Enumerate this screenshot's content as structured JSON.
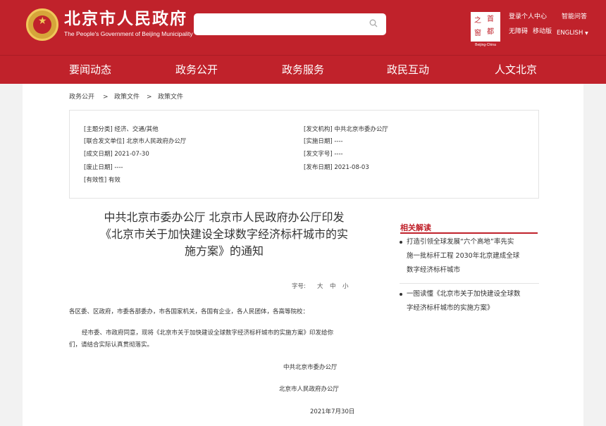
{
  "header": {
    "site_title": "北京市人民政府",
    "site_subtitle": "The People's Government of Beijing Municipality",
    "search": {
      "placeholder": ""
    },
    "logo_chars": [
      "之",
      "首",
      "窗",
      "都"
    ],
    "logo_caption": "Beijing-China",
    "links": {
      "personal_center": "登录个人中心",
      "smart_qa": "智能问答",
      "accessibility": "无障碍",
      "mobile": "移动版",
      "language": "ENGLISH"
    }
  },
  "nav": [
    "要闻动态",
    "政务公开",
    "政务服务",
    "政民互动",
    "人文北京"
  ],
  "breadcrumb": [
    "政务公开",
    "政策文件",
    "政策文件"
  ],
  "meta_left": [
    "[主题分类] 经济、交通/其他",
    "[联合发文单位] 北京市人民政府办公厅",
    "[成文日期] 2021-07-30",
    "[废止日期] ----",
    "[有效性] 有效"
  ],
  "meta_right": [
    "[发文机构] 中共北京市委办公厅",
    "[实施日期] ----",
    "[发文字号] ----",
    "[发布日期] 2021-08-03"
  ],
  "document": {
    "title_lines": [
      "中共北京市委办公厅 北京市人民政府办公厅印发",
      "《北京市关于加快建设全球数字经济标杆城市的实",
      "施方案》的通知"
    ],
    "font_size_label": "字号:",
    "font_sizes": [
      "大",
      "中",
      "小"
    ],
    "salutation": "各区委、区政府，市委各部委办，市各国家机关，各国有企业，各人民团体，各高等院校：",
    "body_lines": [
      "经市委、市政府同意，现将《北京市关于加快建设全球数字经济标杆城市的实施方案》印发给你",
      "们，请结合实际认真贯彻落实。"
    ],
    "signatures": [
      "中共北京市委办公厅",
      "北京市人民政府办公厅",
      "2021年7月30日"
    ]
  },
  "sidebar": {
    "heading": "相关解读",
    "items": [
      [
        "打造引领全球发展“六个高地”率先实",
        "施一批标杆工程 2030年北京建成全球",
        "数字经济标杆城市"
      ],
      [
        "一图读懂《北京市关于加快建设全球数",
        "字经济标杆城市的实施方案》"
      ]
    ]
  },
  "colors": {
    "brand_red": "#c0222b",
    "gold": "#d6a53a",
    "page_bg": "#f2f2f2"
  }
}
